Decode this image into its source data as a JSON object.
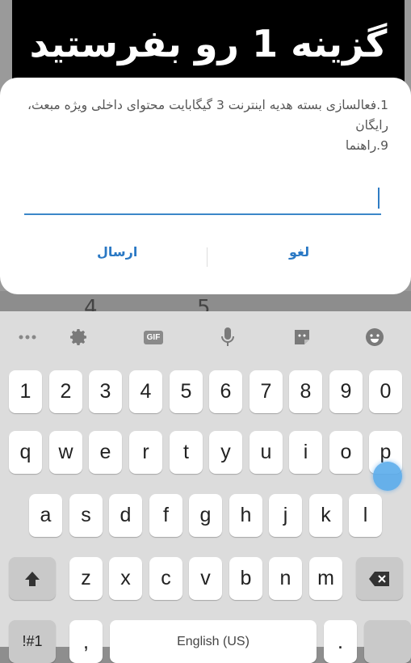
{
  "banner": {
    "text": "گزینه 1 رو بفرستید"
  },
  "background": {
    "ghost_digits": [
      "4",
      "5"
    ]
  },
  "dialog": {
    "message": "1.فعالسازی بسته هدیه اینترنت 3 گیگابایت محتوای داخلی ویژه مبعث، رایگان\n9.راهنما",
    "input_value": "",
    "send_label": "ارسال",
    "cancel_label": "لغو"
  },
  "keyboard": {
    "toolbar": [
      "more-icon",
      "settings-icon",
      "gif-icon",
      "mic-icon",
      "sticker-icon",
      "emoji-icon"
    ],
    "gif_label": "GIF",
    "row_numbers": [
      "1",
      "2",
      "3",
      "4",
      "5",
      "6",
      "7",
      "8",
      "9",
      "0"
    ],
    "row_top": [
      "q",
      "w",
      "e",
      "r",
      "t",
      "y",
      "u",
      "i",
      "o",
      "p"
    ],
    "row_home": [
      "a",
      "s",
      "d",
      "f",
      "g",
      "h",
      "j",
      "k",
      "l"
    ],
    "row_bottom": [
      "z",
      "x",
      "c",
      "v",
      "b",
      "n",
      "m"
    ],
    "mode_label": "!#1",
    "comma_label": ",",
    "space_label": "English (US)",
    "period_label": "."
  }
}
